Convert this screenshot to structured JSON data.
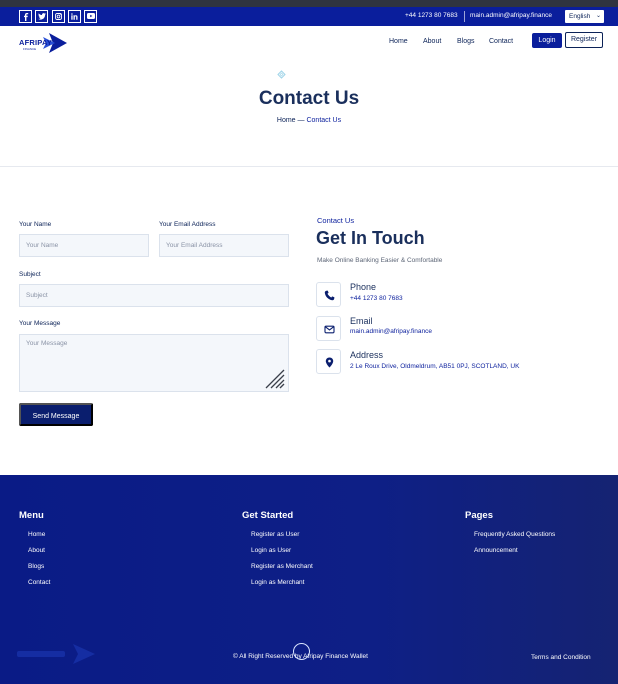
{
  "topbar": {
    "phone": "+44 1273 80 7683",
    "email": "main.admin@afripay.finance",
    "language": "English",
    "socials": [
      "facebook-icon",
      "twitter-icon",
      "instagram-icon",
      "linkedin-icon",
      "youtube-icon"
    ]
  },
  "brand": {
    "name": "AFRIPAY",
    "tagline": "FINANCE",
    "primary_color": "#0a1e9c",
    "footer_color": "#0e1f86"
  },
  "nav": {
    "links": [
      "Home",
      "About",
      "Blogs",
      "Contact"
    ],
    "login": "Login",
    "register": "Register"
  },
  "hero": {
    "title": "Contact Us",
    "breadcrumb_home": "Home",
    "breadcrumb_sep": "—",
    "breadcrumb_current": "Contact Us"
  },
  "form": {
    "name_label": "Your Name",
    "name_placeholder": "Your Name",
    "email_label": "Your Email Address",
    "email_placeholder": "Your Email Address",
    "subject_label": "Subject",
    "subject_placeholder": "Subject",
    "message_label": "Your Message",
    "message_placeholder": "Your Message",
    "submit": "Send Message"
  },
  "contact": {
    "eyebrow": "Contact Us",
    "title": "Get In Touch",
    "subtitle": "Make Online Banking Easier & Comfortable",
    "items": [
      {
        "title": "Phone",
        "value": "+44 1273 80 7683",
        "icon": "phone-icon"
      },
      {
        "title": "Email",
        "value": "main.admin@afripay.finance",
        "icon": "mail-icon"
      },
      {
        "title": "Address",
        "value": "2 Le Roux Drive, Oldmeldrum, AB51 0PJ, SCOTLAND, UK",
        "icon": "location-pin-icon"
      }
    ]
  },
  "footer": {
    "columns": [
      {
        "title": "Menu",
        "links": [
          "Home",
          "About",
          "Blogs",
          "Contact"
        ]
      },
      {
        "title": "Get Started",
        "links": [
          "Register as User",
          "Login as User",
          "Register as Merchant",
          "Login as Merchant"
        ]
      },
      {
        "title": "Pages",
        "links": [
          "Frequently Asked Questions",
          "Announcement"
        ]
      }
    ],
    "copyright": "© All Right Reserved by Afripay Finance Wallet",
    "terms": "Terms and Condition"
  }
}
